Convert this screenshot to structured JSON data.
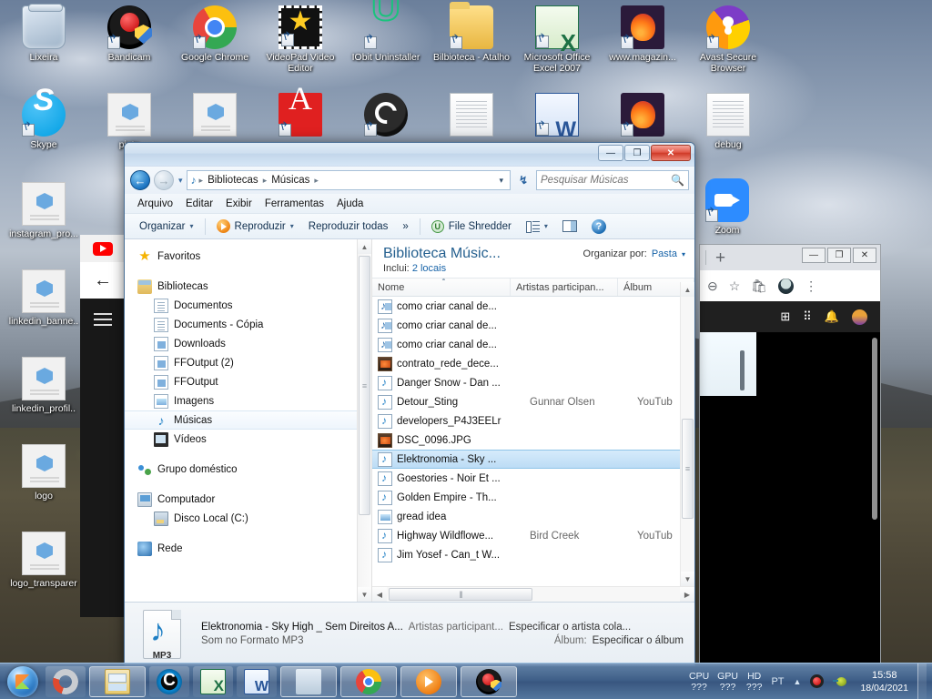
{
  "desktop": {
    "icons_row1": [
      {
        "label": "Lixeira",
        "icon": "recycle-bin-icon",
        "art": "ic-trash",
        "shortcut": false
      },
      {
        "label": "Bandicam",
        "icon": "bandicam-icon",
        "art": "ic-bandicam",
        "shortcut": true
      },
      {
        "label": "Google Chrome",
        "icon": "google-chrome-icon",
        "art": "ic-chrome",
        "shortcut": true
      },
      {
        "label": "VideoPad Video Editor",
        "icon": "videopad-icon",
        "art": "ic-videopad",
        "shortcut": true
      },
      {
        "label": "IObit Uninstaller",
        "icon": "iobit-uninstaller-icon",
        "art": "ic-iobit",
        "shortcut": true
      },
      {
        "label": "Bilbioteca - Atalho",
        "icon": "folder-shortcut-icon",
        "art": "ic-folder",
        "shortcut": true
      },
      {
        "label": "Microsoft Office Excel 2007",
        "icon": "excel-icon",
        "art": "ic-excel",
        "shortcut": true
      },
      {
        "label": "www.magazin...",
        "icon": "firefox-shortcut-icon",
        "art": "ic-firefox",
        "shortcut": true
      },
      {
        "label": "Avast Secure Browser",
        "icon": "avast-browser-icon",
        "art": "ic-avast",
        "shortcut": true
      }
    ],
    "icons_row2": [
      {
        "label": "Skype",
        "icon": "skype-icon",
        "art": "ic-skype",
        "shortcut": true
      },
      {
        "label": "pinte",
        "icon": "image-file-icon",
        "art": "ic-img",
        "shortcut": false
      },
      {
        "label": "",
        "icon": "image-file-icon",
        "art": "ic-img",
        "shortcut": false
      },
      {
        "label": "",
        "icon": "pdf-file-icon",
        "art": "ic-pdf",
        "shortcut": true
      },
      {
        "label": "",
        "icon": "obs-studio-icon",
        "art": "ic-obs",
        "shortcut": true
      },
      {
        "label": "",
        "icon": "text-file-icon",
        "art": "ic-txt",
        "shortcut": false
      },
      {
        "label": "",
        "icon": "word-icon",
        "art": "ic-word",
        "shortcut": true
      },
      {
        "label": "",
        "icon": "firefox-icon",
        "art": "ic-firefox",
        "shortcut": true
      },
      {
        "label": "debug",
        "icon": "text-file-icon",
        "art": "ic-txt",
        "shortcut": false
      }
    ],
    "icons_left_column": [
      {
        "label": "instagram_pro...",
        "icon": "image-file-icon",
        "art": "ic-img"
      },
      {
        "label": "linkedin_banne..",
        "icon": "image-file-icon",
        "art": "ic-img"
      },
      {
        "label": "linkedin_profil..",
        "icon": "image-file-icon",
        "art": "ic-img"
      },
      {
        "label": "logo",
        "icon": "image-file-icon",
        "art": "ic-img"
      },
      {
        "label": "logo_transparer",
        "icon": "image-file-icon",
        "art": "ic-img"
      }
    ],
    "zoom_icon": {
      "label": "Zoom",
      "icon": "zoom-app-icon",
      "art": "ic-zoom"
    }
  },
  "explorer": {
    "window_buttons": {
      "minimize": "—",
      "maximize": "❐",
      "close": "✕"
    },
    "nav": {
      "back_glyph": "←",
      "forward_glyph": "→",
      "recent_caret": "▾",
      "address_icon": "music-note-icon",
      "breadcrumbs": [
        "Bibliotecas",
        "Músicas"
      ],
      "breadcrumb_sep": "▸",
      "dropdown_caret": "▾",
      "refresh_glyph": "↯",
      "search_placeholder": "Pesquisar Músicas",
      "search_value": "",
      "search_icon": "search-icon"
    },
    "menubar": [
      "Arquivo",
      "Editar",
      "Exibir",
      "Ferramentas",
      "Ajuda"
    ],
    "toolbar": {
      "organizar": "Organizar",
      "reproduzir": "Reproduzir",
      "reproduzir_todas": "Reproduzir todas",
      "overflow": "»",
      "file_shredder": "File Shredder",
      "shredder_badge": "U",
      "view_caret": "▾",
      "help_glyph": "?"
    },
    "library": {
      "title": "Biblioteca Músic...",
      "includes_label": "Inclui:",
      "includes_value": "2 locais",
      "organize_by_label": "Organizar por:",
      "organize_by_value": "Pasta",
      "organize_by_caret": "▾"
    },
    "nav_pane": {
      "favoritos": {
        "label": "Favoritos",
        "icon": "star-icon",
        "art": "ico-star"
      },
      "bibliotecas": {
        "label": "Bibliotecas",
        "icon": "libraries-icon",
        "art": "ico-libs"
      },
      "library_items": [
        {
          "label": "Documentos",
          "icon": "document-folder-icon",
          "art": "ico-doc",
          "selected": false
        },
        {
          "label": "Documents - Cópia",
          "icon": "document-folder-icon",
          "art": "ico-doc",
          "selected": false
        },
        {
          "label": "Downloads",
          "icon": "downloads-folder-icon",
          "art": "ico-dl",
          "selected": false
        },
        {
          "label": "FFOutput (2)",
          "icon": "downloads-folder-icon",
          "art": "ico-dl",
          "selected": false
        },
        {
          "label": "FFOutput",
          "icon": "downloads-folder-icon",
          "art": "ico-dl",
          "selected": false
        },
        {
          "label": "Imagens",
          "icon": "pictures-folder-icon",
          "art": "ico-img2",
          "selected": false
        },
        {
          "label": "Músicas",
          "icon": "music-folder-icon",
          "art": "ico-mus",
          "selected": true
        },
        {
          "label": "Vídeos",
          "icon": "videos-folder-icon",
          "art": "ico-vid",
          "selected": false
        }
      ],
      "grupo_domestico": {
        "label": "Grupo doméstico",
        "icon": "homegroup-icon",
        "art": "ico-home"
      },
      "computador": {
        "label": "Computador",
        "icon": "computer-icon",
        "art": "ico-comp"
      },
      "disco_local": {
        "label": "Disco Local (C:)",
        "icon": "hard-disk-icon",
        "art": "ico-disk"
      },
      "rede": {
        "label": "Rede",
        "icon": "network-icon",
        "art": "ico-net"
      }
    },
    "columns": [
      "Nome",
      "Artistas participan...",
      "Álbum"
    ],
    "files": [
      {
        "name": "como criar canal de...",
        "artist": "",
        "album": "",
        "icon": "wmv-file-icon",
        "art": "fi-wmv",
        "selected": false
      },
      {
        "name": "como criar canal de...",
        "artist": "",
        "album": "",
        "icon": "wmv-file-icon",
        "art": "fi-wmv",
        "selected": false
      },
      {
        "name": "como criar canal de...",
        "artist": "",
        "album": "",
        "icon": "wmv-file-icon",
        "art": "fi-wmv",
        "selected": false
      },
      {
        "name": "contrato_rede_dece...",
        "artist": "",
        "album": "",
        "icon": "jpg-file-icon",
        "art": "fi-jpg",
        "selected": false
      },
      {
        "name": "Danger Snow - Dan ...",
        "artist": "",
        "album": "",
        "icon": "mp3-file-icon",
        "art": "fi-mp3",
        "selected": false
      },
      {
        "name": "Detour_Sting",
        "artist": "Gunnar Olsen",
        "album": "YouTub",
        "icon": "mp3-file-icon",
        "art": "fi-mp3",
        "selected": false
      },
      {
        "name": "developers_P4J3EELr",
        "artist": "",
        "album": "",
        "icon": "mp3-file-icon",
        "art": "fi-mp3",
        "selected": false
      },
      {
        "name": "DSC_0096.JPG",
        "artist": "",
        "album": "",
        "icon": "jpg-file-icon",
        "art": "fi-jpg",
        "selected": false
      },
      {
        "name": "Elektronomia - Sky ...",
        "artist": "",
        "album": "",
        "icon": "mp3-file-icon",
        "art": "fi-mp3",
        "selected": true
      },
      {
        "name": "Goestories - Noir Et ...",
        "artist": "",
        "album": "",
        "icon": "mp3-file-icon",
        "art": "fi-mp3",
        "selected": false
      },
      {
        "name": "Golden Empire - Th...",
        "artist": "",
        "album": "",
        "icon": "mp3-file-icon",
        "art": "fi-mp3",
        "selected": false
      },
      {
        "name": "gread idea",
        "artist": "",
        "album": "",
        "icon": "png-file-icon",
        "art": "fi-png",
        "selected": false
      },
      {
        "name": "Highway Wildflowe...",
        "artist": "Bird Creek",
        "album": "YouTub",
        "icon": "mp3-file-icon",
        "art": "fi-mp3",
        "selected": false
      },
      {
        "name": "Jim Yosef - Can_t W...",
        "artist": "",
        "album": "",
        "icon": "mp3-file-icon",
        "art": "fi-mp3",
        "selected": false
      }
    ],
    "details": {
      "title": "Elektronomia - Sky High _ Sem Direitos A...",
      "artists_label": "Artistas participant...",
      "artists_value": "Especificar o artista cola...",
      "format": "Som no Formato MP3",
      "album_label": "Álbum:",
      "album_value": "Especificar o álbum",
      "icon_caption": "MP3"
    }
  },
  "youtube_strip": {
    "logo_icon": "youtube-logo-icon",
    "back_glyph": "←",
    "menu_icon": "hamburger-menu-icon"
  },
  "chrome_window": {
    "new_tab_glyph": "+",
    "window_buttons": {
      "minimize": "—",
      "maximize": "❐",
      "close": "✕"
    },
    "toolbar_icons": [
      "zoom-out-icon",
      "bookmark-star-icon",
      "shopping-bag-icon",
      "profile-avatar-icon",
      "kebab-menu-icon"
    ],
    "yt_bar_icons": [
      "create-video-icon",
      "apps-grid-icon",
      "notifications-bell-icon",
      "account-avatar-icon"
    ]
  },
  "taskbar": {
    "start_button": "start-orb",
    "buttons": [
      {
        "name": "camtasia-taskbar-button",
        "art": "tbi-camtasia",
        "state": "pinned"
      },
      {
        "name": "windows-explorer-taskbar-button",
        "art": "tbi-explorer",
        "state": "active"
      },
      {
        "name": "ccleaner-taskbar-button",
        "art": "tbi-ccleaner",
        "state": "pinned"
      },
      {
        "name": "excel-taskbar-button",
        "art": "tbi-excel",
        "state": "pinned"
      },
      {
        "name": "word-taskbar-button",
        "art": "tbi-word",
        "state": "pinned"
      },
      {
        "name": "media-player-taskbar-button",
        "art": "tbi-wmp2",
        "state": "active"
      },
      {
        "name": "chrome-taskbar-button",
        "art": "tbi-chrome2",
        "state": "active"
      },
      {
        "name": "wmp-taskbar-button",
        "art": "tbi-wmp",
        "state": "active"
      },
      {
        "name": "bandicam-taskbar-button",
        "art": "tbi-bandicam2",
        "state": "active"
      }
    ],
    "tray": {
      "stats": [
        {
          "key": "CPU",
          "value": "???"
        },
        {
          "key": "GPU",
          "value": "???"
        },
        {
          "key": "HD",
          "value": "???"
        }
      ],
      "language": "PT",
      "caret": "▲",
      "record_icon": "record-indicator-icon",
      "bug_icon": "bug-tray-icon",
      "time": "15:58",
      "date": "18/04/2021"
    }
  },
  "colors": {
    "accent_blue": "#1763a8",
    "library_title": "#25608f",
    "selection_blue": "#bcdcf5",
    "taskbar_blue": "#3e608c",
    "close_red": "#cf3a28"
  }
}
